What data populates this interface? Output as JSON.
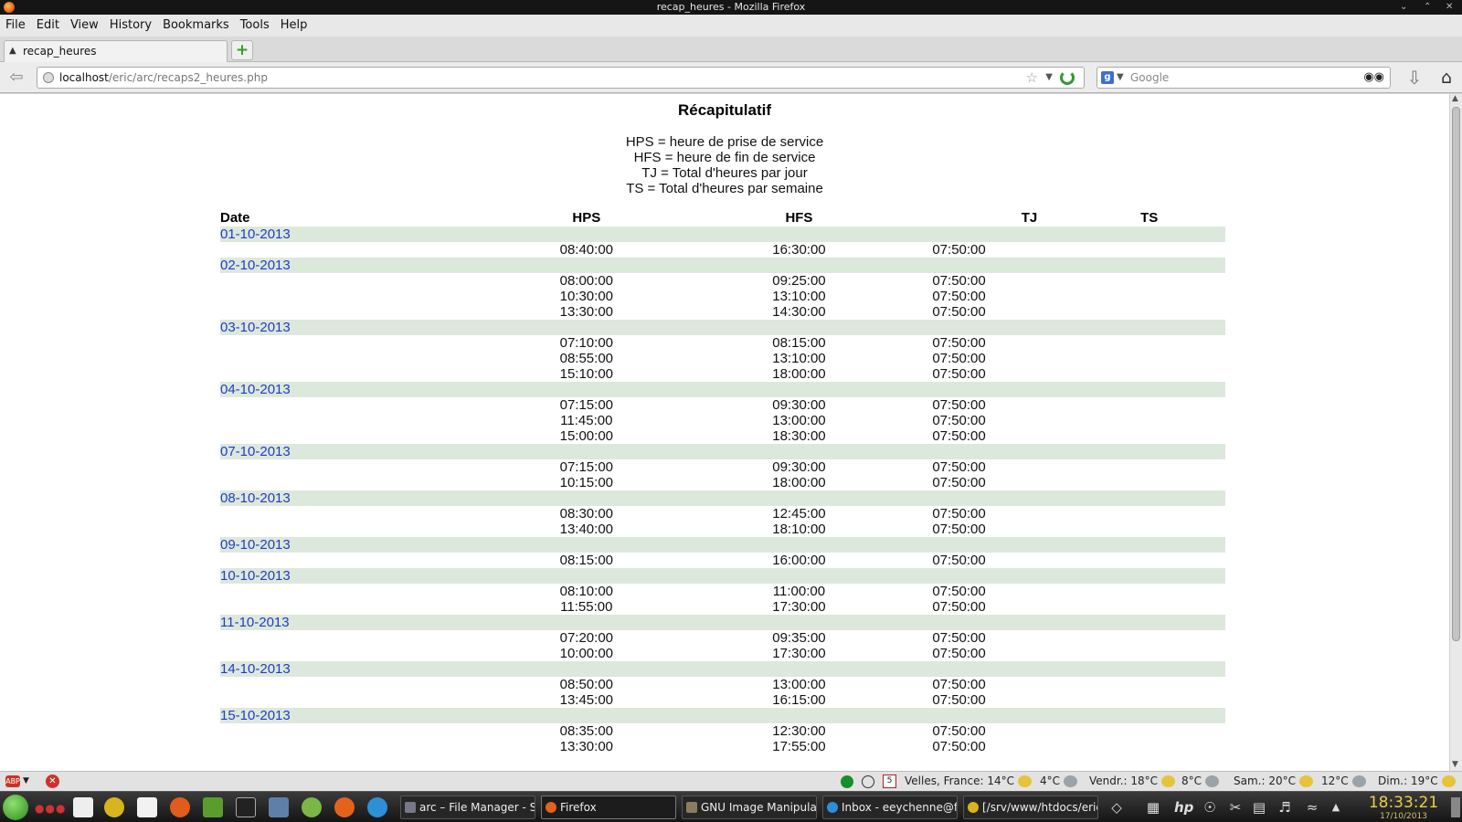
{
  "window": {
    "title": "recap_heures - Mozilla Firefox"
  },
  "menu": [
    "File",
    "Edit",
    "View",
    "History",
    "Bookmarks",
    "Tools",
    "Help"
  ],
  "tab": {
    "title": "recap_heures"
  },
  "urlbar": {
    "host": "localhost",
    "path": "/eric/arc/recaps2_heures.php"
  },
  "searchbar": {
    "placeholder": "Google"
  },
  "page": {
    "title": "Récapitulatif",
    "legend": [
      "HPS = heure de prise de service",
      "HFS = heure de fin de service",
      "TJ = Total d'heures par jour",
      "TS = Total d'heures par semaine"
    ],
    "columns": [
      "Date",
      "HPS",
      "HFS",
      "TJ",
      "TS"
    ],
    "days": [
      {
        "date": "01-10-2013",
        "entries": [
          [
            "08:40:00",
            "16:30:00",
            "07:50:00"
          ]
        ]
      },
      {
        "date": "02-10-2013",
        "entries": [
          [
            "08:00:00",
            "09:25:00",
            "07:50:00"
          ],
          [
            "10:30:00",
            "13:10:00",
            "07:50:00"
          ],
          [
            "13:30:00",
            "14:30:00",
            "07:50:00"
          ]
        ]
      },
      {
        "date": "03-10-2013",
        "entries": [
          [
            "07:10:00",
            "08:15:00",
            "07:50:00"
          ],
          [
            "08:55:00",
            "13:10:00",
            "07:50:00"
          ],
          [
            "15:10:00",
            "18:00:00",
            "07:50:00"
          ]
        ]
      },
      {
        "date": "04-10-2013",
        "entries": [
          [
            "07:15:00",
            "09:30:00",
            "07:50:00"
          ],
          [
            "11:45:00",
            "13:00:00",
            "07:50:00"
          ],
          [
            "15:00:00",
            "18:30:00",
            "07:50:00"
          ]
        ]
      },
      {
        "date": "07-10-2013",
        "entries": [
          [
            "07:15:00",
            "09:30:00",
            "07:50:00"
          ],
          [
            "10:15:00",
            "18:00:00",
            "07:50:00"
          ]
        ]
      },
      {
        "date": "08-10-2013",
        "entries": [
          [
            "08:30:00",
            "12:45:00",
            "07:50:00"
          ],
          [
            "13:40:00",
            "18:10:00",
            "07:50:00"
          ]
        ]
      },
      {
        "date": "09-10-2013",
        "entries": [
          [
            "08:15:00",
            "16:00:00",
            "07:50:00"
          ]
        ]
      },
      {
        "date": "10-10-2013",
        "entries": [
          [
            "08:10:00",
            "11:00:00",
            "07:50:00"
          ],
          [
            "11:55:00",
            "17:30:00",
            "07:50:00"
          ]
        ]
      },
      {
        "date": "11-10-2013",
        "entries": [
          [
            "07:20:00",
            "09:35:00",
            "07:50:00"
          ],
          [
            "10:00:00",
            "17:30:00",
            "07:50:00"
          ]
        ]
      },
      {
        "date": "14-10-2013",
        "entries": [
          [
            "08:50:00",
            "13:00:00",
            "07:50:00"
          ],
          [
            "13:45:00",
            "16:15:00",
            "07:50:00"
          ]
        ]
      },
      {
        "date": "15-10-2013",
        "entries": [
          [
            "08:35:00",
            "12:30:00",
            "07:50:00"
          ],
          [
            "13:30:00",
            "17:55:00",
            "07:50:00"
          ]
        ]
      }
    ]
  },
  "statusbar": {
    "calendar_day": "5",
    "weather": [
      {
        "label": "Velles, France: 14°C",
        "icon": "sun-cloud-icon"
      },
      {
        "label": "4°C",
        "icon": "cloud-icon"
      },
      {
        "label": "Vendr.: 18°C",
        "icon": "sun-cloud-icon"
      },
      {
        "label": "8°C",
        "icon": "cloud-icon"
      },
      {
        "label": "Sam.: 20°C",
        "icon": "sun-icon"
      },
      {
        "label": "12°C",
        "icon": "cloud-icon"
      },
      {
        "label": "Dim.: 19°C",
        "icon": "sun-cloud-icon"
      }
    ]
  },
  "taskbar": {
    "tasks": [
      {
        "label": "arc – File Manager - S",
        "active": false
      },
      {
        "label": "Firefox",
        "active": true
      },
      {
        "label": "GNU Image Manipulat",
        "active": false
      },
      {
        "label": "Inbox - eeychenne@fr",
        "active": false
      },
      {
        "label": "[/srv/www/htdocs/eric/",
        "active": false
      }
    ],
    "time": "18:33:21",
    "date": "17/10/2013"
  }
}
